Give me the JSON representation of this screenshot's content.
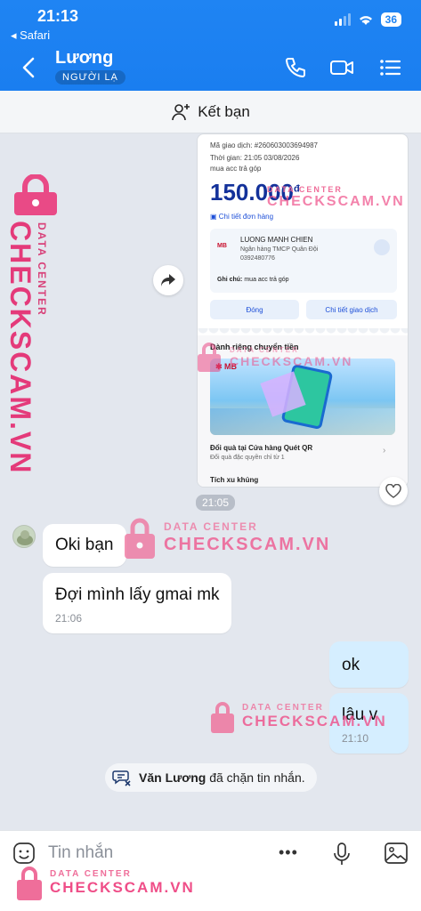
{
  "status_bar": {
    "time": "21:13",
    "back_app": "Safari",
    "battery": "36"
  },
  "header": {
    "title": "Lương",
    "tag": "NGƯỜI LẠ"
  },
  "friend_bar": {
    "label": "Kết bạn"
  },
  "receipt": {
    "transaction_id": "Mã giao dịch: #260603003694987",
    "time": "Thời gian: 21:05 03/08/2026",
    "note_top": "mua acc trả góp",
    "amount": "150.000",
    "currency": "đ",
    "order_detail": "Chi tiết đơn hàng",
    "recipient_name": "LUONG MANH CHIEN",
    "bank": "Ngân hàng TMCP Quân Đội",
    "account": "0392480776",
    "note_label": "Ghi chú:",
    "note": "mua acc trả góp",
    "close_btn": "Đóng",
    "detail_btn": "Chi tiết giao dịch",
    "section_title": "Dành riêng chuyển tiền",
    "reward_title": "Đổi quà tại Cửa hàng Quét QR",
    "reward_sub": "Đổi quà đặc quyền chỉ từ 1",
    "coins_title": "Tích xu khủng",
    "bank_logo": "MB"
  },
  "messages": {
    "time_chip": "21:05",
    "m1": "Oki bạn",
    "m2": "Đợi mình lấy gmai mk",
    "m2_time": "21:06",
    "m3": "ok",
    "m4": "lâu v",
    "m4_time": "21:10"
  },
  "system": {
    "name": "Văn Lương",
    "text": "đã chặn tin nhắn."
  },
  "composer": {
    "placeholder": "Tin nhắn",
    "more": "•••"
  },
  "watermark": {
    "small": "DATA CENTER",
    "big": "CHECKSCAM.VN"
  }
}
